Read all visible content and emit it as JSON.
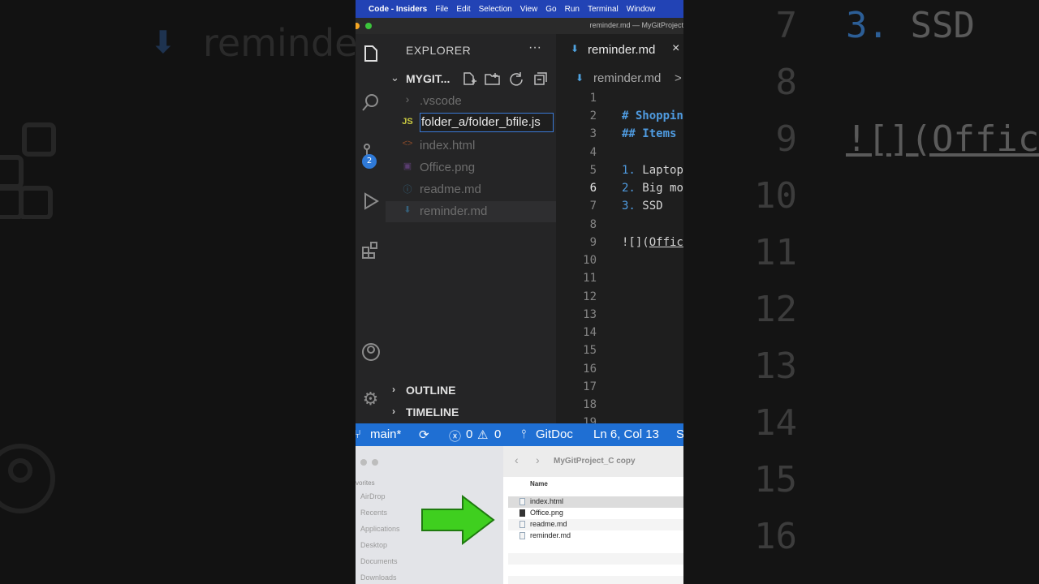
{
  "background": {
    "left_ghost_text": "reminde",
    "right_line_numbers": [
      "7",
      "8",
      "9",
      "10",
      "11",
      "12",
      "13",
      "14",
      "15",
      "16"
    ],
    "right_code": [
      {
        "num": "3.",
        "text": "SSD"
      },
      {
        "text": "![](Offic"
      }
    ]
  },
  "menubar": {
    "apple_icon": "apple-icon",
    "app_name": "Code - Insiders",
    "items": [
      "File",
      "Edit",
      "Selection",
      "View",
      "Go",
      "Run",
      "Terminal",
      "Window"
    ]
  },
  "window": {
    "title": "reminder.md — MyGitProject"
  },
  "activity_bar": {
    "icons": [
      "files-icon",
      "search-icon",
      "source-control-icon",
      "run-debug-icon",
      "extensions-icon",
      "account-icon",
      "settings-gear-icon"
    ],
    "source_control_badge": "2"
  },
  "sidebar": {
    "title": "EXPLORER",
    "more_label": "···",
    "project_name": "MYGIT...",
    "toolbar_icons": [
      "new-file-icon",
      "new-folder-icon",
      "refresh-icon",
      "collapse-all-icon"
    ],
    "files": [
      {
        "name": ".vscode",
        "icon": "chevron-right-icon",
        "glyph": "›",
        "color": "#6d6d6d"
      },
      {
        "name": "folder_a/folder_bfile.js",
        "icon": "js-icon",
        "glyph": "JS",
        "color": "#cbcb41",
        "editing": true
      },
      {
        "name": "index.html",
        "icon": "html-icon",
        "glyph": "<>",
        "color": "#e37933"
      },
      {
        "name": "Office.png",
        "icon": "image-icon",
        "glyph": "▣",
        "color": "#a074c4"
      },
      {
        "name": "readme.md",
        "icon": "info-icon",
        "glyph": "ⓘ",
        "color": "#519aba"
      },
      {
        "name": "reminder.md",
        "icon": "markdown-icon",
        "glyph": "⬇",
        "color": "#519aba",
        "active": true
      }
    ],
    "sections": [
      "OUTLINE",
      "TIMELINE"
    ]
  },
  "editor": {
    "tab_label": "reminder.md",
    "close_glyph": "×",
    "breadcrumb": "reminder.md",
    "breadcrumb_sep": ">",
    "line_numbers": [
      "1",
      "2",
      "3",
      "4",
      "5",
      "6",
      "7",
      "8",
      "9",
      "10",
      "11",
      "12",
      "13",
      "14",
      "15",
      "16",
      "17",
      "18",
      "19"
    ],
    "current_line": "6",
    "lines": {
      "l2": "# Shoppin",
      "l3": "## Items",
      "l5_num": "1.",
      "l5_text": "Laptop",
      "l6_num": "2.",
      "l6_text": "Big mo",
      "l7_num": "3.",
      "l7_text": "SSD",
      "l9_pre": "![](",
      "l9_link": "Offic"
    }
  },
  "statusbar": {
    "branch": "main*",
    "sync_glyph": "⟳",
    "errors": "0",
    "warnings": "0",
    "gitdoc": "GitDoc",
    "position": "Ln 6, Col 13",
    "tail": "S",
    "color": "#1f6fd3"
  },
  "finder": {
    "title": "MyGitProject_C copy",
    "sidebar_header": "vorites",
    "sidebar_items": [
      "AirDrop",
      "Recents",
      "Applications",
      "Desktop",
      "Documents",
      "Downloads"
    ],
    "column_header": "Name",
    "files": [
      "index.html",
      "Office.png",
      "readme.md",
      "reminder.md"
    ],
    "arrow_color": "#3fcf1f"
  }
}
